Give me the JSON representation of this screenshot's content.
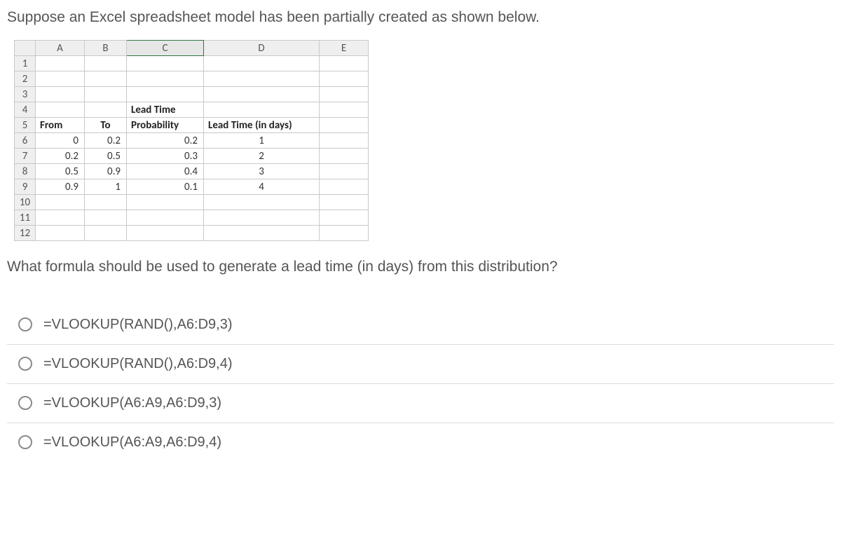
{
  "prompt": "Suppose an Excel spreadsheet model has been partially created as shown below.",
  "question": "What formula should be used to generate a lead time (in days) from this distribution?",
  "spreadsheet": {
    "cols": [
      "A",
      "B",
      "C",
      "D",
      "E"
    ],
    "rows": [
      "1",
      "2",
      "3",
      "4",
      "5",
      "6",
      "7",
      "8",
      "9",
      "10",
      "11",
      "12"
    ],
    "headers": {
      "c4": "Lead Time",
      "a5": "From",
      "b5": "To",
      "c5": "Probability",
      "d5": "Lead Time (in days)"
    },
    "data": [
      {
        "from": "0",
        "to": "0.2",
        "prob": "0.2",
        "lead": "1"
      },
      {
        "from": "0.2",
        "to": "0.5",
        "prob": "0.3",
        "lead": "2"
      },
      {
        "from": "0.5",
        "to": "0.9",
        "prob": "0.4",
        "lead": "3"
      },
      {
        "from": "0.9",
        "to": "1",
        "prob": "0.1",
        "lead": "4"
      }
    ]
  },
  "options": [
    "=VLOOKUP(RAND(),A6:D9,3)",
    "=VLOOKUP(RAND(),A6:D9,4)",
    "=VLOOKUP(A6:A9,A6:D9,3)",
    "=VLOOKUP(A6:A9,A6:D9,4)"
  ]
}
